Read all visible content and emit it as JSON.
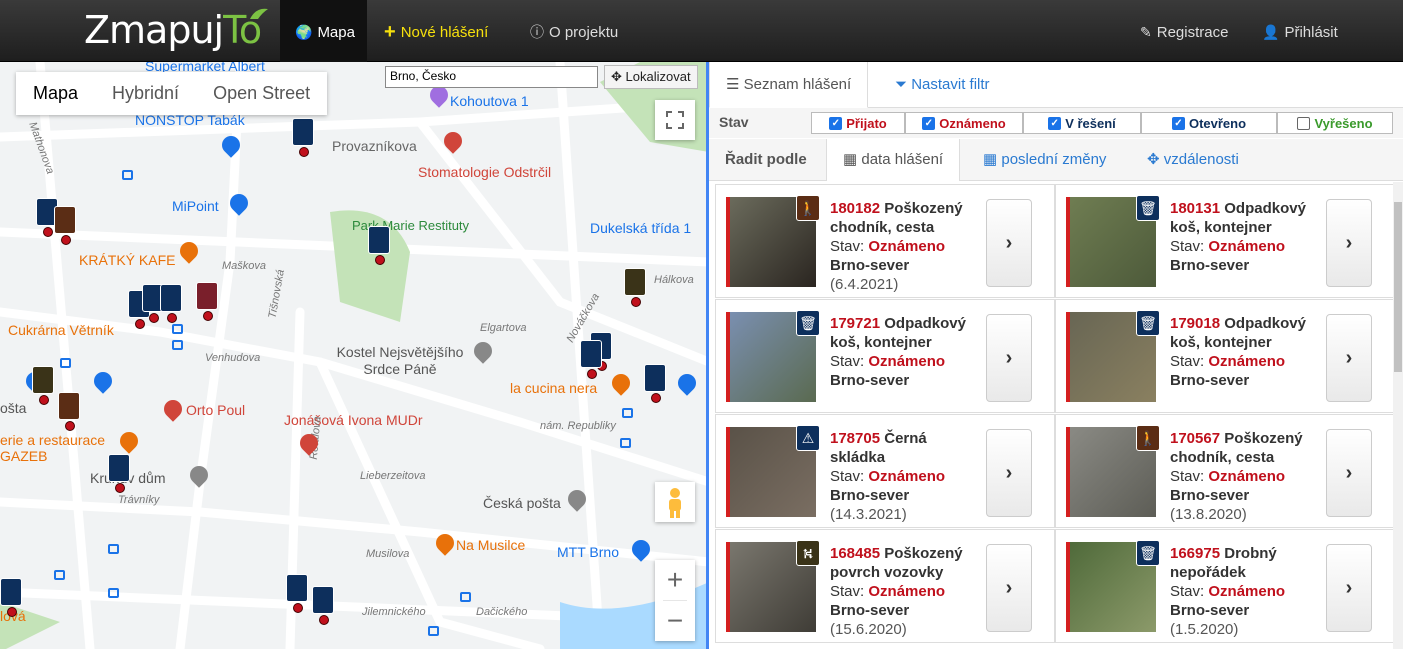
{
  "navbar": {
    "logo_main": "Zmapuj",
    "logo_accent": "To",
    "items": [
      {
        "label": "Mapa",
        "icon": "globe-icon"
      },
      {
        "label": "Nové hlášení",
        "icon": "plus-icon"
      },
      {
        "label": "O projektu",
        "icon": "info-icon"
      }
    ],
    "right": [
      {
        "label": "Registrace",
        "icon": "pencil-icon"
      },
      {
        "label": "Přihlásit",
        "icon": "user-icon"
      }
    ]
  },
  "map": {
    "types": [
      "Mapa",
      "Hybridní",
      "Open Street"
    ],
    "search_value": "Brno, Česko",
    "locate_label": "Lokalizovat",
    "labels": [
      "Supermarket Albert",
      "Kohoutova 1",
      "NONSTOP Tabák",
      "Provazníkova",
      "Stomatologie Odstrčil",
      "MiPoint",
      "Park Marie Restituty",
      "Dukelská třída 1",
      "KRÁTKÝ KAFE",
      "Maškova",
      "Hálkova",
      "Cukrárna Větrník",
      "Elgartova",
      "Venhudova",
      "Kostel Nejsvětějšího Srdce Páně",
      "la cucina nera",
      "Orto Poul",
      "Jonášová Ivona MUDr",
      "nám. Republiky",
      "erie a restaurace GAZEB",
      "Kruhův dům",
      "Lieberzeitova",
      "Česká pošta",
      "Trávníky",
      "Na Musilce",
      "MTT Brno",
      "Musilova",
      "Jilemnického",
      "Dačického",
      "Tišnovská",
      "Rotalova",
      "Nováčkova",
      "Mathonova",
      "lová",
      "ošta"
    ]
  },
  "panel": {
    "tabs": [
      "Seznam hlášení",
      "Nastavit filtr"
    ],
    "stav_label": "Stav",
    "filters": [
      {
        "label": "Přijato",
        "checked": true,
        "color": "#c0101c"
      },
      {
        "label": "Oznámeno",
        "checked": true,
        "color": "#c0101c"
      },
      {
        "label": "V řešení",
        "checked": true,
        "color": "#0d2f5c"
      },
      {
        "label": "Otevřeno",
        "checked": true,
        "color": "#0d2f5c"
      },
      {
        "label": "Vyřešeno",
        "checked": false,
        "color": "#3a9a2b"
      }
    ],
    "sort_label": "Řadit podle",
    "sort_options": [
      "data hlášení",
      "poslední změny",
      "vzdálenosti"
    ],
    "state_prefix": "Stav: ",
    "reports": [
      {
        "id": "180182",
        "title": "Poškozený chodník, cesta",
        "state": "Oznámeno",
        "area": "Brno-sever",
        "date": "(6.4.2021)",
        "cat": "pedestrian-icon",
        "cat_color": "brown"
      },
      {
        "id": "180131",
        "title": "Odpadkový koš, kontejner",
        "state": "Oznámeno",
        "area": "Brno-sever",
        "date": "",
        "cat": "trash-icon",
        "cat_color": "navy"
      },
      {
        "id": "179721",
        "title": "Odpadkový koš, kontejner",
        "state": "Oznámeno",
        "area": "Brno-sever",
        "date": "",
        "cat": "trash-icon",
        "cat_color": "navy"
      },
      {
        "id": "179018",
        "title": "Odpadkový koš, kontejner",
        "state": "Oznámeno",
        "area": "Brno-sever",
        "date": "",
        "cat": "trash-icon",
        "cat_color": "navy"
      },
      {
        "id": "178705",
        "title": "Černá skládka",
        "state": "Oznámeno",
        "area": "Brno-sever",
        "date": "(14.3.2021)",
        "cat": "dump-icon",
        "cat_color": "navy"
      },
      {
        "id": "170567",
        "title": "Poškozený chodník, cesta",
        "state": "Oznámeno",
        "area": "Brno-sever",
        "date": "(13.8.2020)",
        "cat": "pedestrian-icon",
        "cat_color": "brown"
      },
      {
        "id": "168485",
        "title": "Poškozený povrch vozovky",
        "state": "Oznámeno",
        "area": "Brno-sever",
        "date": "(15.6.2020)",
        "cat": "road-icon",
        "cat_color": "olive"
      },
      {
        "id": "166975",
        "title": "Drobný nepořádek",
        "state": "Oznámeno",
        "area": "Brno-sever",
        "date": "(1.5.2020)",
        "cat": "trash-icon",
        "cat_color": "navy"
      }
    ]
  }
}
